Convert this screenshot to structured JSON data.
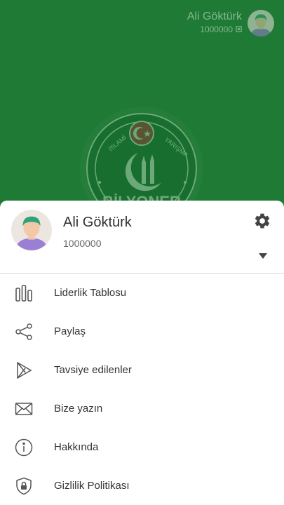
{
  "header": {
    "user_name": "Ali Göktürk",
    "points": "1000000"
  },
  "logo": {
    "top_text_left": "İSLAMİ",
    "top_text_right": "YARIŞMA",
    "bottom_text": "BİLYONER"
  },
  "profile": {
    "name": "Ali Göktürk",
    "points": "1000000"
  },
  "menu": {
    "items": [
      {
        "label": "Liderlik Tablosu",
        "icon": "leaderboard-icon"
      },
      {
        "label": "Paylaş",
        "icon": "share-icon"
      },
      {
        "label": "Tavsiye edilenler",
        "icon": "play-store-icon"
      },
      {
        "label": "Bize yazın",
        "icon": "mail-icon"
      },
      {
        "label": "Hakkında",
        "icon": "info-icon"
      },
      {
        "label": "Gizlilik Politikası",
        "icon": "privacy-lock-icon"
      }
    ]
  },
  "colors": {
    "background": "#1e7a34",
    "sheet": "#ffffff",
    "flag_red": "#c8102e",
    "avatar_hair": "#2fa37a",
    "avatar_shirt": "#9b7fd4",
    "avatar_skin": "#f3c8a8"
  }
}
